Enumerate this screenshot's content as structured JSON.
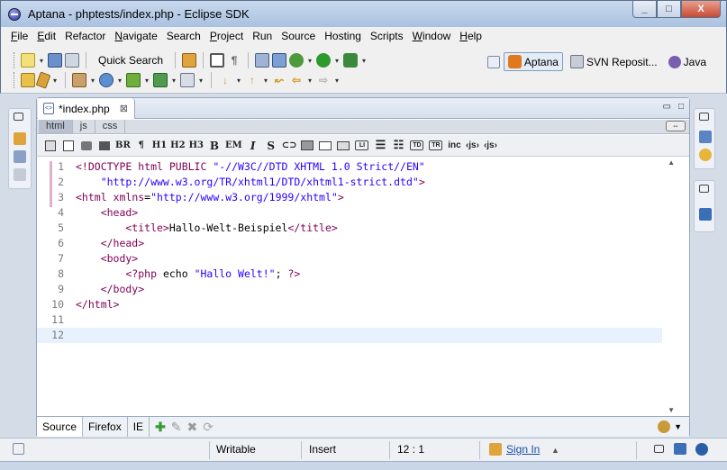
{
  "window": {
    "title": "Aptana - phptests/index.php - Eclipse SDK",
    "min_glyph": "_",
    "max_glyph": "□",
    "close_glyph": "X"
  },
  "menubar": {
    "items": [
      {
        "label": "File",
        "underline": "F",
        "rest": "ile"
      },
      {
        "label": "Edit",
        "underline": "E",
        "rest": "dit"
      },
      {
        "label": "Refactor",
        "underline": "",
        "rest": "Refactor"
      },
      {
        "label": "Navigate",
        "underline": "N",
        "rest": "avigate"
      },
      {
        "label": "Search",
        "underline": "",
        "rest": "Search"
      },
      {
        "label": "Project",
        "underline": "P",
        "rest": "roject"
      },
      {
        "label": "Run",
        "underline": "",
        "rest": "Run"
      },
      {
        "label": "Source",
        "underline": "",
        "rest": "Source"
      },
      {
        "label": "Hosting",
        "underline": "",
        "rest": "Hosting"
      },
      {
        "label": "Scripts",
        "underline": "",
        "rest": "Scripts"
      },
      {
        "label": "Window",
        "underline": "W",
        "rest": "indow"
      },
      {
        "label": "Help",
        "underline": "H",
        "rest": "elp"
      }
    ]
  },
  "toolbar": {
    "quick_search": "Quick Search",
    "perspectives": [
      "Aptana",
      "SVN Reposit...",
      "Java"
    ],
    "colors": {
      "blue": "#3b6fb6",
      "green": "#3a9a3a",
      "orange": "#e08a1c",
      "gray": "#8a8f98",
      "red": "#c03a2b",
      "purple": "#7a4fb0"
    }
  },
  "editor": {
    "tab_label": "*index.php",
    "tab_close": "⊠",
    "subtabs": [
      "html",
      "js",
      "css"
    ],
    "swap_glyph": "⇔",
    "format_buttons": [
      "BR",
      "¶",
      "H1",
      "H2",
      "H3",
      "B",
      "EM",
      "I",
      "S"
    ],
    "box_buttons": [
      "LI",
      "TD",
      "TR"
    ],
    "extra_buttons": [
      "inc",
      "‹js›",
      "‹js›"
    ],
    "lines": [
      {
        "n": "1",
        "parts": [
          [
            "c-tag",
            "<!DOCTYPE html PUBLIC "
          ],
          [
            "c-str",
            "\"-//W3C//DTD XHTML 1.0 Strict//EN\""
          ]
        ]
      },
      {
        "n": "2",
        "parts": [
          [
            "c-str",
            "    \"http://www.w3.org/TR/xhtml1/DTD/xhtml1-strict.dtd\""
          ],
          [
            "c-tag",
            ">"
          ]
        ]
      },
      {
        "n": "3",
        "parts": [
          [
            "c-tag",
            "<html "
          ],
          [
            "c-php",
            "xmlns"
          ],
          [
            "c-txt",
            "="
          ],
          [
            "c-str",
            "\"http://www.w3.org/1999/xhtml\""
          ],
          [
            "c-tag",
            ">"
          ]
        ]
      },
      {
        "n": "4",
        "parts": [
          [
            "c-tag",
            "    <head>"
          ]
        ]
      },
      {
        "n": "5",
        "parts": [
          [
            "c-tag",
            "        <title>"
          ],
          [
            "c-txt",
            "Hallo-Welt-Beispiel"
          ],
          [
            "c-tag",
            "</title>"
          ]
        ]
      },
      {
        "n": "6",
        "parts": [
          [
            "c-tag",
            "    </head>"
          ]
        ]
      },
      {
        "n": "7",
        "parts": [
          [
            "c-tag",
            "    <body>"
          ]
        ]
      },
      {
        "n": "8",
        "parts": [
          [
            "c-tag",
            "        <?php "
          ],
          [
            "c-txt",
            "echo "
          ],
          [
            "c-str",
            "\"Hallo Welt!\""
          ],
          [
            "c-txt",
            "; "
          ],
          [
            "c-tag",
            "?>"
          ]
        ]
      },
      {
        "n": "9",
        "parts": [
          [
            "c-tag",
            "    </body>"
          ]
        ]
      },
      {
        "n": "10",
        "parts": [
          [
            "c-tag",
            "</html>"
          ]
        ]
      },
      {
        "n": "11",
        "parts": []
      },
      {
        "n": "12",
        "parts": []
      }
    ],
    "current_line": "12",
    "bottom_tabs": [
      "Source",
      "Firefox",
      "IE"
    ],
    "bottom_icons": [
      "✚",
      "✎",
      "✖",
      "⟳"
    ]
  },
  "statusbar": {
    "writable": "Writable",
    "insert": "Insert",
    "position": "12 : 1",
    "sign_in": "Sign In"
  }
}
